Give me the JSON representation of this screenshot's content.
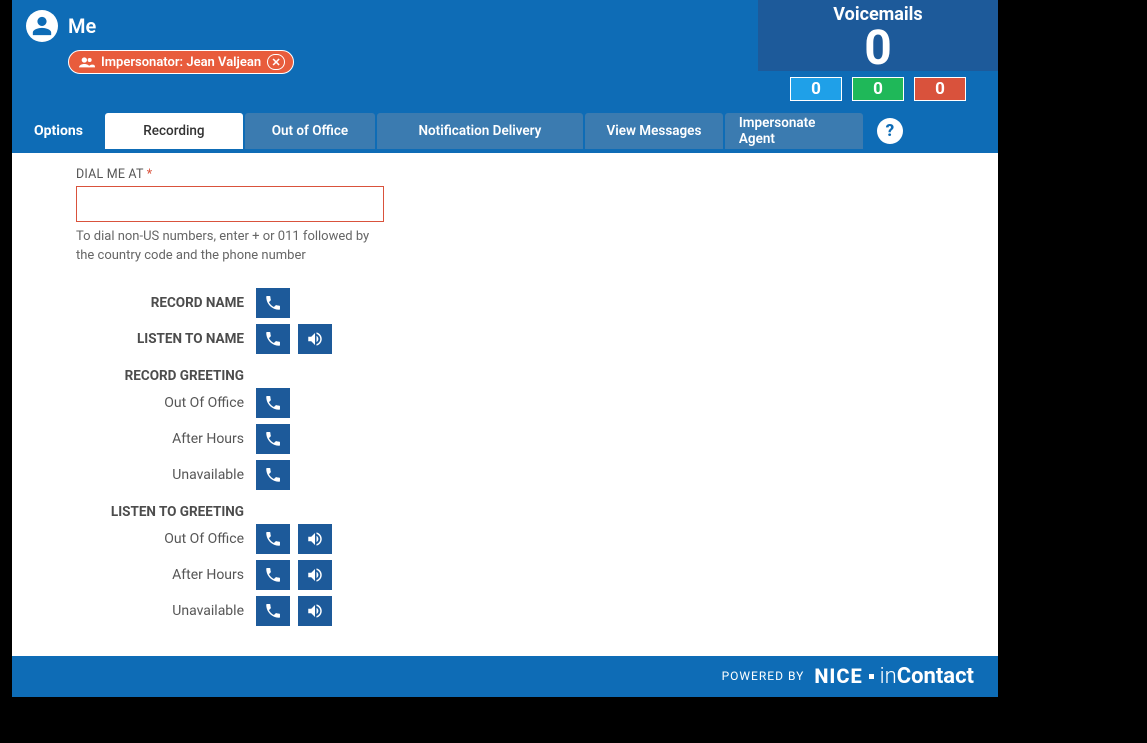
{
  "header": {
    "user_name": "Me",
    "impersonator_prefix": "Impersonator:",
    "impersonator_name": "Jean Valjean"
  },
  "voicemails": {
    "title": "Voicemails",
    "total": "0",
    "new": "0",
    "saved": "0",
    "deleted": "0"
  },
  "tabs": {
    "options_label": "Options",
    "items": [
      {
        "label": "Recording",
        "active": true
      },
      {
        "label": "Out of Office",
        "active": false
      },
      {
        "label": "Notification Delivery",
        "active": false
      },
      {
        "label": "View Messages",
        "active": false
      },
      {
        "label": "Impersonate Agent",
        "active": false
      }
    ],
    "help": "?"
  },
  "form": {
    "dial_label": "DIAL ME AT",
    "dial_required_marker": "*",
    "dial_value": "",
    "dial_hint": "To dial non-US numbers, enter + or 011 followed by the country code and the phone number",
    "record_name_label": "RECORD NAME",
    "listen_name_label": "LISTEN TO NAME",
    "record_greeting_header": "RECORD GREETING",
    "listen_greeting_header": "LISTEN TO GREETING",
    "greetings": {
      "out_of_office": "Out Of Office",
      "after_hours": "After Hours",
      "unavailable": "Unavailable"
    }
  },
  "footer": {
    "powered_by": "POWERED BY",
    "brand_nice": "NICE",
    "brand_in": "in",
    "brand_contact": "Contact"
  }
}
